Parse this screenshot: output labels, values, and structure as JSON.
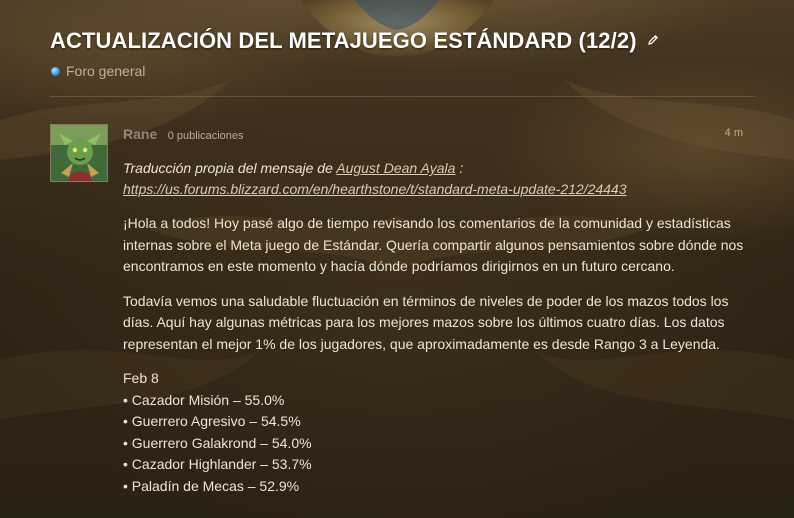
{
  "topic": {
    "title": "ACTUALIZACIÓN DEL METAJUEGO ESTÁNDARD (12/2)",
    "category": "Foro general"
  },
  "post": {
    "username": "Rane",
    "post_count": "0 publicaciones",
    "time": "4 m",
    "intro_prefix": "Traducción propia del mensaje de ",
    "author_link": "August Dean Ayala",
    "intro_suffix": " :",
    "source_url": "https://us.forums.blizzard.com/en/hearthstone/t/standard-meta-update-212/24443",
    "paragraph1": "¡Hola a todos! Hoy pasé algo de tiempo revisando los comentarios de la comunidad y estadísticas internas sobre el Meta juego de Estándar. Quería compartir algunos pensamientos sobre dónde nos encontramos en este momento y hacía dónde podríamos dirigirnos en un futuro cercano.",
    "paragraph2": "Todavía vemos una saludable fluctuación en términos de niveles de poder de los mazos todos los días. Aquí hay algunas métricas para los mejores mazos sobre los últimos cuatro días. Los datos representan el mejor 1% de los jugadores, que aproximadamente es desde Rango 3 a Leyenda.",
    "date_label": "Feb 8",
    "stats": [
      "• Cazador Misión – 55.0%",
      "• Guerrero Agresivo – 54.5%",
      "• Guerrero Galakrond – 54.0%",
      "• Cazador Highlander – 53.7%",
      "• Paladín de Mecas – 52.9%"
    ]
  },
  "icons": {
    "edit": "pencil-icon",
    "category": "category-dot-icon",
    "avatar": "user-avatar"
  },
  "colors": {
    "title": "#ffffff",
    "username": "#8f877a",
    "body_text": "#eee4d1",
    "category_dot": "#2f8fd0"
  }
}
